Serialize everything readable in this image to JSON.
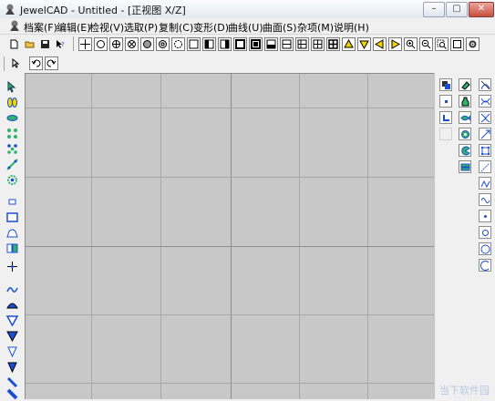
{
  "window": {
    "title": "JewelCAD - Untitled - [正视图 X/Z]",
    "buttons": {
      "minimize": "–",
      "maximize": "▢",
      "close": "✕"
    }
  },
  "menu": [
    {
      "label": "档案(F)"
    },
    {
      "label": "编辑(E)"
    },
    {
      "label": "检视(V)"
    },
    {
      "label": "选取(P)"
    },
    {
      "label": "复制(C)"
    },
    {
      "label": "变形(D)"
    },
    {
      "label": "曲线(U)"
    },
    {
      "label": "曲面(S)"
    },
    {
      "label": "杂项(M)"
    },
    {
      "label": "说明(H)"
    }
  ],
  "colors": {
    "canvas": "#c8c8c8",
    "grid": "#a7a7a7",
    "accent_blue": "#1b4fd1",
    "accent_yellow": "#f2d400",
    "accent_green": "#2fb26b"
  },
  "watermark": {
    "text": "当下软件园"
  },
  "toolbar": {
    "file": [
      "new-icon",
      "open-icon",
      "save-icon",
      "help-context-icon"
    ],
    "snap": [
      "crosshair-icon",
      "circle-icon",
      "circle-plus-icon",
      "circle-cross-icon",
      "filled-circle-icon",
      "hollow-circle-icon",
      "circle-dash-icon"
    ],
    "views": [
      "view-single-icon",
      "view-half-left-icon",
      "view-half-right-icon",
      "view-frame-icon",
      "view-frame-bold-icon",
      "view-split-v-icon",
      "view-split-h-icon",
      "view-grid-icon",
      "view-grid-bold-icon",
      "view-quad-icon"
    ],
    "nav": [
      "arrow-up-icon",
      "arrow-down-icon",
      "arrow-left-icon",
      "arrow-right-icon",
      "zoom-in-icon",
      "zoom-out-icon",
      "zoom-window-icon",
      "zoom-all-icon",
      "render-icon"
    ]
  }
}
